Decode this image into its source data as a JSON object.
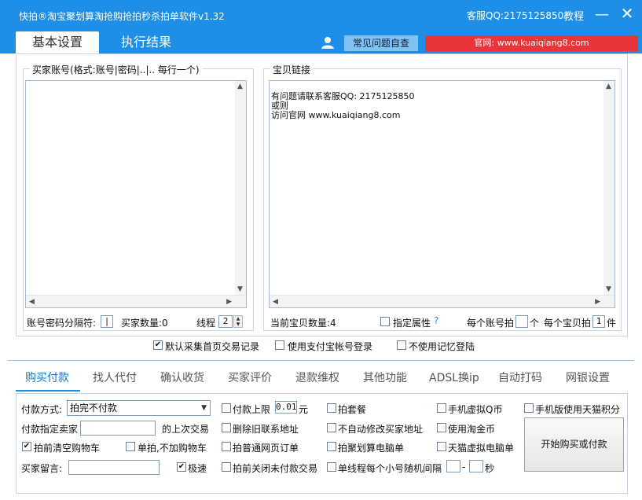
{
  "titlebar": {
    "title": "快拍®淘宝聚划算淘抢购抢拍秒杀拍单软件v1.32",
    "qq": "客服QQ:2175125850",
    "help": "教程",
    "minimize": "—",
    "close": "✕"
  },
  "top_tabs": {
    "basic": "基本设置",
    "result": "执行结果"
  },
  "faq_button": "常见问题自查",
  "site_banner": "官网: www.kuaiqiang8.com",
  "accounts_group": {
    "legend": "买家账号(格式:账号|密码|..|..  每行一个)",
    "separator_label": "账号密码分隔符:",
    "separator_value": "|",
    "count_label": "买家数量:0",
    "threads_label": "线程",
    "threads_value": "2"
  },
  "links_group": {
    "legend": "宝贝链接",
    "content": [
      "有问题请联系客服QQ: 2175125850",
      "或则",
      "访问官网 www.kuaiqiang8.com"
    ],
    "count_label": "当前宝贝数量:4",
    "attr_label": "指定属性",
    "attr_help": "?",
    "per_account_label": "每个账号拍",
    "per_account_unit": "个",
    "per_item_label": "每个宝贝拍",
    "per_item_value": "1",
    "per_item_unit": "件"
  },
  "options_row": {
    "default_collect": "默认采集首页交易记录",
    "use_alipay": "使用支付宝帐号登录",
    "no_memory": "不使用记忆登陆"
  },
  "bottom_tabs": [
    "购买付款",
    "找人代付",
    "确认收货",
    "买家评价",
    "退款维权",
    "其他功能",
    "ADSL换ip",
    "自动打码",
    "网银设置"
  ],
  "payment": {
    "method_label": "付款方式:",
    "method_value": "拍完不付款",
    "seller_label": "付款指定卖家",
    "last_trade": "的上次交易",
    "clear_cart": "拍前清空购物车",
    "single_no_cart": "单拍,不加购物车",
    "message_label": "买家留言:",
    "fast": "极速",
    "limit_label": "付款上限",
    "limit_value": "0.01",
    "limit_unit": "元",
    "delete_old_addr": "删除旧联系地址",
    "normal_page": "拍普通网页订单",
    "close_unpaid": "拍前关闭未付款交易",
    "package": "拍套餐",
    "no_modify_addr": "不自动修改买家地址",
    "juhuasuan_pc": "拍聚划算电脑单",
    "single_thread": "单线程每个小号随机间隔",
    "dash": "-",
    "seconds": "秒",
    "virtual_q": "手机虚拟Q币",
    "taobao_coin": "使用淘金币",
    "tmall_virtual": "天猫虚拟电脑单",
    "tmall_points": "手机版使用天猫积分",
    "start_button": "开始购买或付款"
  },
  "colors": {
    "titlebar": "#1e8ee6",
    "banner_red": "#e9353a",
    "faq_bg": "#7fc2f4",
    "active_tab": "#1677c9"
  },
  "icons": {
    "user": "user-icon",
    "checked": "✔"
  }
}
